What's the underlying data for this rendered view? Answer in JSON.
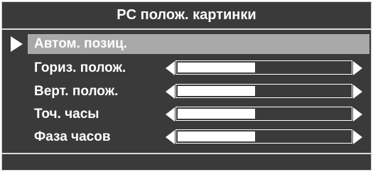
{
  "title": "PC полож. картинки",
  "items": [
    {
      "label": "Автом. позиц.",
      "selected": true
    },
    {
      "label": "Гориз. полож.",
      "level": 0.45
    },
    {
      "label": "Верт. полож.",
      "level": 0.45
    },
    {
      "label": "Точ. часы",
      "level": 0.45
    },
    {
      "label": "Фаза часов",
      "level": 0.45
    }
  ],
  "colors": {
    "background": "#3a3a3a",
    "highlight": "#a8a8a8",
    "text": "#ffffff"
  }
}
